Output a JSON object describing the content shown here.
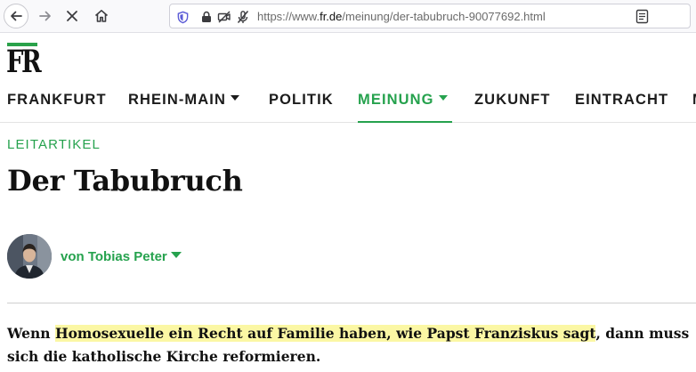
{
  "browser": {
    "url_scheme": "https://www.",
    "url_domain": "fr.de",
    "url_path": "/meinung/der-tabubruch-90077692.html",
    "icons": [
      "back-icon",
      "forward-icon",
      "stop-icon",
      "home-icon",
      "shield-icon",
      "lock-icon",
      "camera-blocked-icon",
      "mic-blocked-icon",
      "reader-view-icon"
    ]
  },
  "site": {
    "logo": "FR",
    "nav": [
      {
        "label": "FRANKFURT",
        "dropdown": false,
        "active": false
      },
      {
        "label": "RHEIN-MAIN",
        "dropdown": true,
        "active": false
      },
      {
        "label": "POLITIK",
        "dropdown": false,
        "active": false
      },
      {
        "label": "MEINUNG",
        "dropdown": true,
        "active": true
      },
      {
        "label": "ZUKUNFT",
        "dropdown": false,
        "active": false
      },
      {
        "label": "EINTRACHT",
        "dropdown": false,
        "active": false
      },
      {
        "label": "M",
        "dropdown": false,
        "active": false
      }
    ],
    "accent_color": "#26a24e"
  },
  "article": {
    "kicker": "LEITARTIKEL",
    "headline": "Der Tabubruch",
    "author": "von Tobias Peter",
    "lead_highlight": "Homosexuelle ein Recht auf Familie haben, wie Papst Franziskus sagt",
    "lead_before": "Wenn ",
    "lead_after": ", dann muss sich die katholische Kirche reformieren.",
    "highlight_color": "#fbf7a4"
  }
}
